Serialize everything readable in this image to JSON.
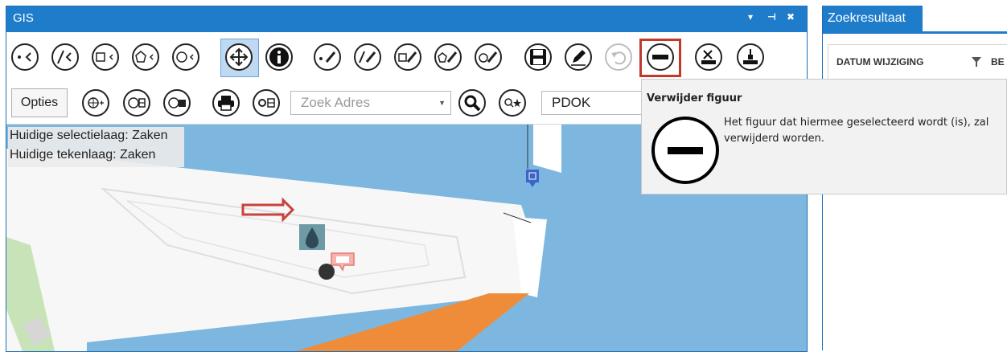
{
  "gis": {
    "title": "GIS",
    "window_controls": {
      "dropdown": "▾",
      "pin": "⊣",
      "close": "✖"
    },
    "toolbar1": {
      "buttons": [
        {
          "icon": "select-point-icon",
          "active": false
        },
        {
          "icon": "select-line-icon",
          "active": false
        },
        {
          "icon": "select-rectangle-icon",
          "active": false
        },
        {
          "icon": "select-polygon-icon",
          "active": false
        },
        {
          "icon": "select-circle-icon",
          "active": false
        },
        {
          "icon": "pan-move-icon",
          "active": true
        },
        {
          "icon": "info-icon",
          "active": false
        },
        {
          "icon": "draw-point-icon",
          "active": false
        },
        {
          "icon": "draw-line-icon",
          "active": false
        },
        {
          "icon": "draw-rectangle-icon",
          "active": false
        },
        {
          "icon": "draw-polygon-icon",
          "active": false
        },
        {
          "icon": "draw-circle-icon",
          "active": false
        },
        {
          "icon": "save-icon",
          "active": false
        },
        {
          "icon": "edit-icon",
          "active": false
        },
        {
          "icon": "undo-icon",
          "active": false,
          "disabled": true
        },
        {
          "icon": "remove-figure-icon",
          "active": false,
          "highlighted": true
        },
        {
          "icon": "layer-remove-icon",
          "active": false
        },
        {
          "icon": "layer-add-icon",
          "active": false
        }
      ]
    },
    "toolbar2": {
      "opties_label": "Opties",
      "search_placeholder": "Zoek Adres",
      "map_source": "PDOK"
    },
    "info": {
      "selection_layer": "Huidige selectielaag: Zaken",
      "drawing_layer": "Huidige tekenlaag: Zaken"
    }
  },
  "results": {
    "tab_title": "Zoekresultaat",
    "columns": [
      "DATUM WIJZIGING",
      "BE"
    ]
  },
  "tooltip": {
    "title": "Verwijder figuur",
    "text": "Het figuur dat hiermee geselecteerd wordt (is), zal verwijderd worden."
  },
  "colors": {
    "accent": "#1f7ccb",
    "water": "#7db7df",
    "highlight": "#c0392b",
    "route": "#ee8c3a"
  }
}
